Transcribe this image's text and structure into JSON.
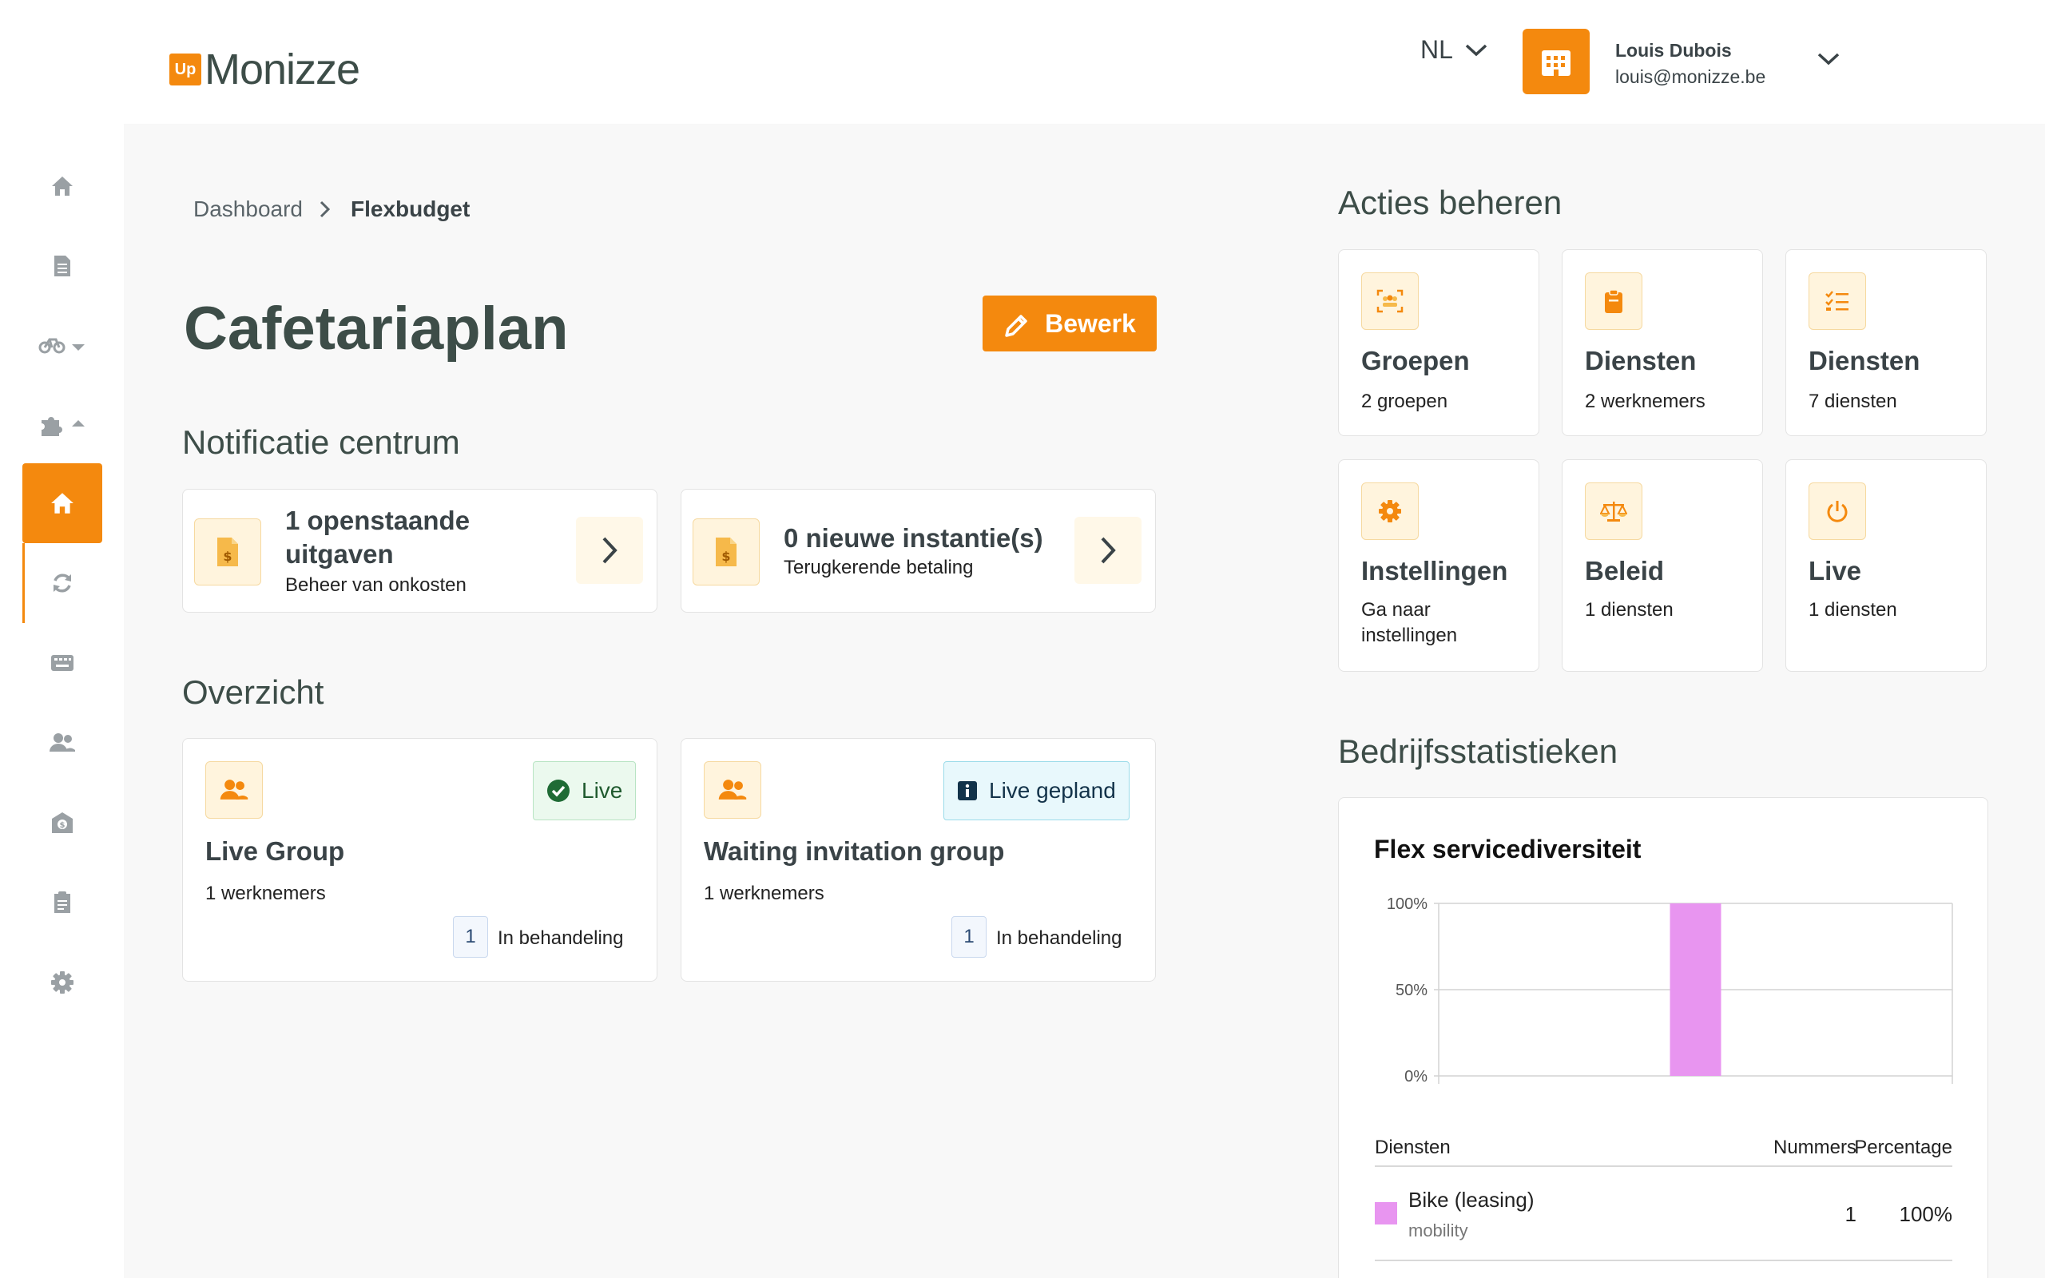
{
  "header": {
    "logo_badge": "Up",
    "logo_text": "Monizze",
    "language": "NL",
    "user_name": "Louis Dubois",
    "user_email": "louis@monizze.be"
  },
  "sidebar": {
    "items": [
      {
        "icon": "home-icon"
      },
      {
        "icon": "document-icon"
      },
      {
        "icon": "bike-icon"
      },
      {
        "icon": "puzzle-icon"
      },
      {
        "icon": "home-icon",
        "active": true
      },
      {
        "icon": "refresh-icon"
      },
      {
        "icon": "keyboard-icon"
      },
      {
        "icon": "users-icon"
      },
      {
        "icon": "envelope-money-icon"
      },
      {
        "icon": "report-icon"
      },
      {
        "icon": "gear-icon"
      }
    ]
  },
  "breadcrumb": {
    "item1": "Dashboard",
    "item2": "Flexbudget"
  },
  "page": {
    "title": "Cafetariaplan",
    "edit_label": "Bewerk"
  },
  "notifications": {
    "title": "Notificatie centrum",
    "items": [
      {
        "title_line1": "1 openstaande",
        "title_line2": "uitgaven",
        "subtitle": "Beheer van onkosten"
      },
      {
        "title_line1": "0 nieuwe instantie(s)",
        "subtitle": "Terugkerende betaling"
      }
    ]
  },
  "overview": {
    "title": "Overzicht",
    "groups": [
      {
        "name": "Live Group",
        "employees": "1 werknemers",
        "status": "Live",
        "count": "1",
        "pending": "In behandeling"
      },
      {
        "name": "Waiting invitation group",
        "employees": "1 werknemers",
        "status": "Live gepland",
        "count": "1",
        "pending": "In behandeling"
      }
    ]
  },
  "actions": {
    "title": "Acties beheren",
    "items": [
      {
        "title": "Groepen",
        "sub": "2 groepen"
      },
      {
        "title": "Diensten",
        "sub": "2 werknemers"
      },
      {
        "title": "Diensten",
        "sub": "7 diensten"
      },
      {
        "title": "Instellingen",
        "sub": "Ga naar instellingen"
      },
      {
        "title": "Beleid",
        "sub": "1 diensten"
      },
      {
        "title": "Live",
        "sub": "1 diensten"
      }
    ]
  },
  "stats": {
    "title": "Bedrijfsstatistieken",
    "table": {
      "col1": "Diensten",
      "col2": "Nummers",
      "col3": "Percentage",
      "rows": [
        {
          "name": "Bike (leasing)",
          "category": "mobility",
          "number": "1",
          "percentage": "100%",
          "color": "#e895f0"
        }
      ]
    }
  },
  "chart_data": {
    "type": "bar",
    "title": "Flex servicediversiteit",
    "categories": [
      "Bike (leasing)"
    ],
    "values": [
      100
    ],
    "ylim": [
      0,
      100
    ],
    "yticks": [
      "0%",
      "50%",
      "100%"
    ],
    "color": "#e895f0",
    "grid": true
  }
}
